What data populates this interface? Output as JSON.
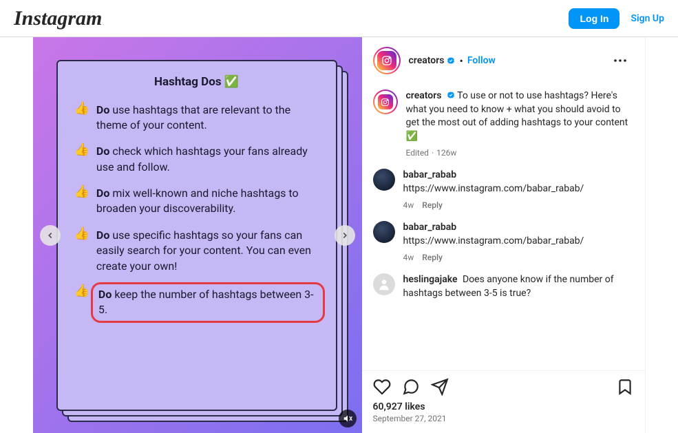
{
  "header": {
    "logo": "Instagram",
    "login": "Log In",
    "signup": "Sign Up"
  },
  "post": {
    "author": "creators",
    "follow": "Follow",
    "caption_author": "creators",
    "caption": "To use or not to use hashtags? Here's what you need to know + what you should avoid to get the most out of adding hashtags to your content ✅",
    "edited": "Edited",
    "caption_age": "126w",
    "likes": "60,927 likes",
    "date": "September 27, 2021"
  },
  "card": {
    "title": "Hashtag Dos ✅",
    "items": [
      {
        "bold": "Do",
        "text": " use hashtags that are relevant to the theme of your content."
      },
      {
        "bold": "Do",
        "text": " check which hashtags your fans already use and follow."
      },
      {
        "bold": "Do",
        "text": " mix well-known and niche hashtags to broaden your discoverability."
      },
      {
        "bold": "Do",
        "text": " use specific hashtags so your fans can easily search for your content. You can even create your own!"
      },
      {
        "bold": "Do",
        "text": " keep the number of hashtags between 3-5."
      }
    ]
  },
  "comments": [
    {
      "user": "babar_rabab",
      "text": "https://www.instagram.com/babar_rabab/",
      "age": "4w",
      "reply": "Reply"
    },
    {
      "user": "babar_rabab",
      "text": "https://www.instagram.com/babar_rabab/",
      "age": "4w",
      "reply": "Reply"
    },
    {
      "user": "heslingajake",
      "text": "Does anyone know if the number of hashtags between 3-5 is true?",
      "age": "",
      "reply": ""
    }
  ]
}
